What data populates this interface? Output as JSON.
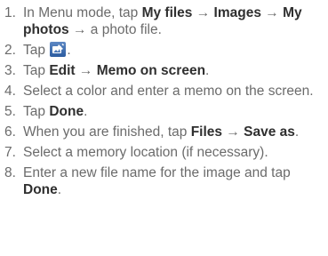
{
  "steps": [
    {
      "num": "1.",
      "parts": [
        {
          "t": "In Menu mode, tap ",
          "b": false
        },
        {
          "t": "My files",
          "b": true
        },
        {
          "t": " → ",
          "b": false
        },
        {
          "t": "Images",
          "b": true
        },
        {
          "t": " → ",
          "b": false
        },
        {
          "t": "My photos",
          "b": true
        },
        {
          "t": " → a photo file.",
          "b": false
        }
      ]
    },
    {
      "num": "2.",
      "parts": [
        {
          "t": "Tap ",
          "b": false
        },
        {
          "icon": "edit-photo-icon"
        },
        {
          "t": ".",
          "b": false
        }
      ]
    },
    {
      "num": "3.",
      "parts": [
        {
          "t": "Tap ",
          "b": false
        },
        {
          "t": "Edit",
          "b": true
        },
        {
          "t": " → ",
          "b": false
        },
        {
          "t": "Memo on screen",
          "b": true
        },
        {
          "t": ".",
          "b": false
        }
      ]
    },
    {
      "num": "4.",
      "parts": [
        {
          "t": "Select a color and enter a memo on the screen.",
          "b": false
        }
      ]
    },
    {
      "num": "5.",
      "parts": [
        {
          "t": "Tap ",
          "b": false
        },
        {
          "t": "Done",
          "b": true
        },
        {
          "t": ".",
          "b": false
        }
      ]
    },
    {
      "num": "6.",
      "parts": [
        {
          "t": "When you are finished, tap ",
          "b": false
        },
        {
          "t": "Files",
          "b": true
        },
        {
          "t": " → ",
          "b": false
        },
        {
          "t": "Save as",
          "b": true
        },
        {
          "t": ".",
          "b": false
        }
      ]
    },
    {
      "num": "7.",
      "parts": [
        {
          "t": "Select a memory location (if necessary).",
          "b": false
        }
      ]
    },
    {
      "num": "8.",
      "parts": [
        {
          "t": "Enter a new file name for the image and tap ",
          "b": false
        },
        {
          "t": "Done",
          "b": true
        },
        {
          "t": ".",
          "b": false
        }
      ]
    }
  ]
}
